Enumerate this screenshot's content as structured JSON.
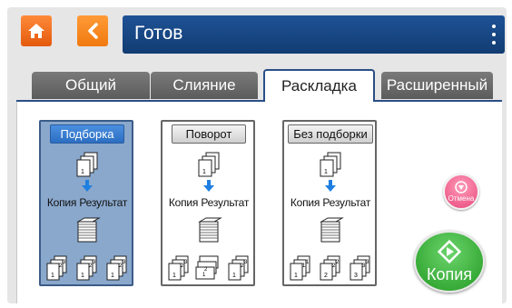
{
  "header": {
    "title": "Готов"
  },
  "tabs": [
    {
      "label": "Общий",
      "active": false
    },
    {
      "label": "Слияние",
      "active": false
    },
    {
      "label": "Раскладка",
      "active": true
    },
    {
      "label": "Расширенный",
      "active": false
    }
  ],
  "options": [
    {
      "label": "Подборка",
      "caption": "Копия Результат",
      "selected": true
    },
    {
      "label": "Поворот",
      "caption": "Копия Результат",
      "selected": false
    },
    {
      "label": "Без подборки",
      "caption": "Копия Результат",
      "selected": false
    }
  ],
  "actions": {
    "cancel_label": "Отмена",
    "copy_label": "Копия"
  },
  "colors": {
    "accent_blue": "#1e5296",
    "home_orange": "#f26b1d",
    "start_green": "#2eaa2e",
    "cancel_pink": "#e8477c"
  }
}
